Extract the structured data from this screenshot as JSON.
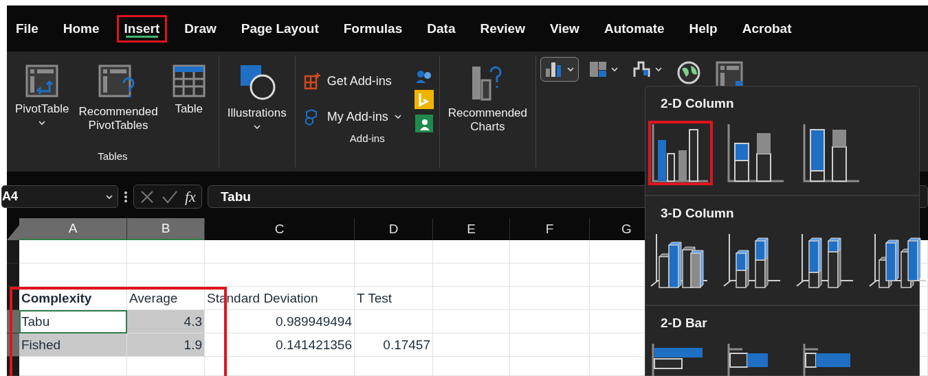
{
  "menu_tabs": [
    {
      "label": "File",
      "selected": false,
      "highlighted": false
    },
    {
      "label": "Home",
      "selected": false,
      "highlighted": false
    },
    {
      "label": "Insert",
      "selected": true,
      "highlighted": true
    },
    {
      "label": "Draw",
      "selected": false,
      "highlighted": false
    },
    {
      "label": "Page Layout",
      "selected": false,
      "highlighted": false
    },
    {
      "label": "Formulas",
      "selected": false,
      "highlighted": false
    },
    {
      "label": "Data",
      "selected": false,
      "highlighted": false
    },
    {
      "label": "Review",
      "selected": false,
      "highlighted": false
    },
    {
      "label": "View",
      "selected": false,
      "highlighted": false
    },
    {
      "label": "Automate",
      "selected": false,
      "highlighted": false
    },
    {
      "label": "Help",
      "selected": false,
      "highlighted": false
    },
    {
      "label": "Acrobat",
      "selected": false,
      "highlighted": false
    }
  ],
  "ribbon": {
    "groups": [
      {
        "kind": "large",
        "label": "Tables",
        "buttons": [
          {
            "kind": "pivot",
            "label": "PivotTable",
            "dropdown": true
          },
          {
            "kind": "recommendedpivot",
            "label": "Recommended PivotTables"
          },
          {
            "kind": "table",
            "label": "Table"
          }
        ]
      },
      {
        "kind": "large",
        "buttons": [
          {
            "kind": "illustrations",
            "label": "Illustrations",
            "dropdown": true
          }
        ]
      },
      {
        "kind": "addins",
        "label": "Add-ins",
        "items": [
          {
            "kind": "store",
            "label": "Get Add-ins"
          },
          {
            "kind": "hex",
            "label": "My Add-ins",
            "dropdown": true
          }
        ]
      },
      {
        "kind": "large",
        "buttons": [
          {
            "kind": "recommendedcharts",
            "label": "Recommended Charts"
          }
        ]
      },
      {
        "kind": "charts",
        "chart_buttons": [
          {
            "kind": "column",
            "pressed": true,
            "dropdown": true
          },
          {
            "kind": "hierarchy",
            "pressed": false,
            "dropdown": true
          },
          {
            "kind": "waterfall",
            "pressed": false,
            "dropdown": true
          },
          {
            "kind": "globe",
            "pressed": false
          },
          {
            "kind": "pivotchart",
            "pressed": false
          }
        ]
      }
    ]
  },
  "formula_bar": {
    "name_box": "A4",
    "function_label": "fx",
    "value": "Tabu"
  },
  "sheet": {
    "columns": [
      {
        "label": "A",
        "selected": true
      },
      {
        "label": "B",
        "selected": true
      },
      {
        "label": "C",
        "selected": false
      },
      {
        "label": "D",
        "selected": false
      },
      {
        "label": "E",
        "selected": false
      },
      {
        "label": "F",
        "selected": false
      },
      {
        "label": "G",
        "selected": false
      }
    ],
    "rows": [
      {
        "selected": false,
        "annotated": false,
        "cells": []
      },
      {
        "selected": false,
        "annotated": false,
        "cells": []
      },
      {
        "selected": false,
        "annotated": true,
        "cells": [
          {
            "text": "Complexity",
            "kind": "heading",
            "selected": false,
            "active": false
          },
          {
            "text": "Average",
            "kind": "text",
            "selected": false,
            "active": false
          },
          {
            "text": "Standard Deviation",
            "kind": "text",
            "selected": false,
            "active": false
          },
          {
            "text": "T Test",
            "kind": "text",
            "selected": false,
            "active": false
          }
        ]
      },
      {
        "selected": true,
        "annotated": true,
        "cells": [
          {
            "text": "Tabu",
            "kind": "text",
            "selected": false,
            "active": true
          },
          {
            "text": "4.3",
            "kind": "number",
            "selected": true,
            "active": false
          },
          {
            "text": "0.989949494",
            "kind": "number",
            "selected": false,
            "active": false
          }
        ]
      },
      {
        "selected": true,
        "annotated": true,
        "cells": [
          {
            "text": "Fished",
            "kind": "text",
            "selected": true,
            "active": false
          },
          {
            "text": "1.9",
            "kind": "number",
            "selected": true,
            "active": false
          },
          {
            "text": "0.141421356",
            "kind": "number",
            "selected": false,
            "active": false
          },
          {
            "text": "0.17457",
            "kind": "number",
            "selected": false,
            "active": false
          }
        ]
      },
      {
        "selected": false,
        "annotated": true,
        "cells": []
      }
    ]
  },
  "chart_menu": {
    "sections": [
      {
        "title": "2-D Column",
        "options": [
          {
            "kind": "clustered",
            "highlighted": true
          },
          {
            "kind": "stacked",
            "highlighted": false
          },
          {
            "kind": "stacked100",
            "highlighted": false
          }
        ]
      },
      {
        "title": "3-D Column",
        "options": [
          {
            "kind": "clustered3d",
            "highlighted": false
          },
          {
            "kind": "stacked3d",
            "highlighted": false
          },
          {
            "kind": "stacked100x3d",
            "highlighted": false
          },
          {
            "kind": "column3d",
            "highlighted": false
          }
        ]
      },
      {
        "title": "2-D Bar",
        "options": [
          {
            "kind": "barclustered",
            "highlighted": false
          },
          {
            "kind": "barstacked",
            "highlighted": false
          },
          {
            "kind": "barstacked100",
            "highlighted": false
          }
        ]
      }
    ]
  }
}
